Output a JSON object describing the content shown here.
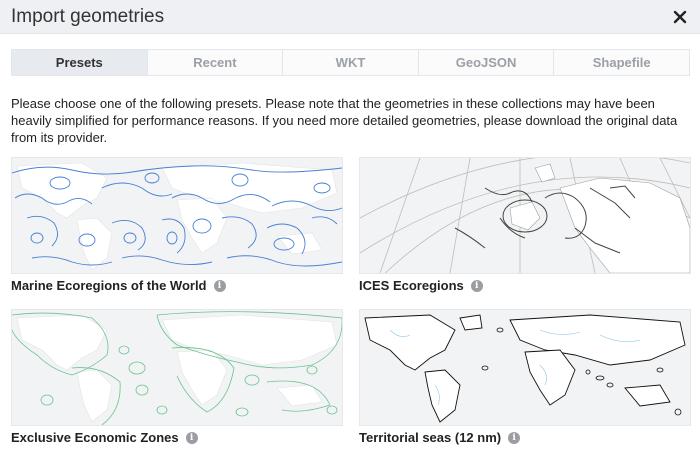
{
  "dialog": {
    "title": "Import geometries"
  },
  "tabs": [
    {
      "label": "Presets",
      "active": true
    },
    {
      "label": "Recent",
      "active": false
    },
    {
      "label": "WKT",
      "active": false
    },
    {
      "label": "GeoJSON",
      "active": false
    },
    {
      "label": "Shapefile",
      "active": false
    }
  ],
  "intro_text": "Please choose one of the following presets. Please note that the geometries in these collections may have been heavily simplified for performance reasons. If you need more detailed geometries, please download the original data from its provider.",
  "presets": [
    {
      "label": "Marine Ecoregions of the World",
      "accent": "#4a7fd6"
    },
    {
      "label": "ICES Ecoregions",
      "accent": "#555555"
    },
    {
      "label": "Exclusive Economic Zones",
      "accent": "#6cc28f"
    },
    {
      "label": "Territorial seas (12 nm)",
      "accent": "#111111"
    }
  ],
  "icons": {
    "close": "close-icon",
    "info": "info-icon"
  }
}
